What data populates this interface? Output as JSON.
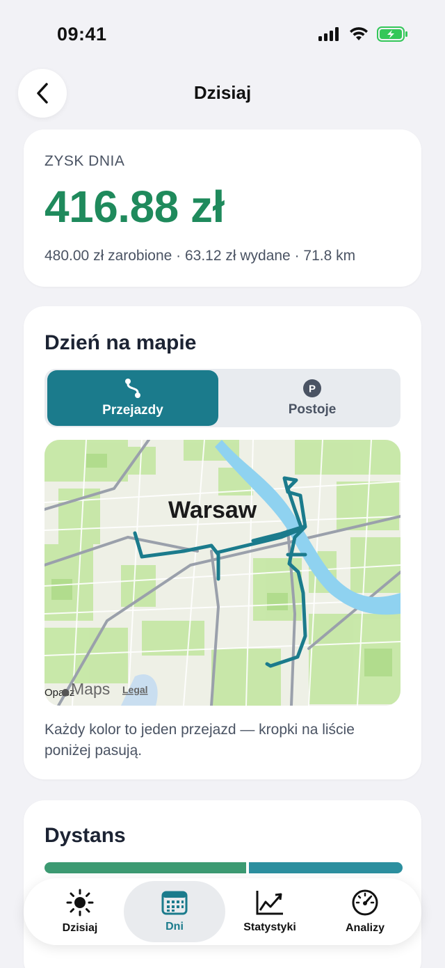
{
  "status_bar": {
    "time": "09:41"
  },
  "header": {
    "title": "Dzisiaj",
    "back_icon": "chevron-left-icon"
  },
  "profit": {
    "label": "ZYSK DNIA",
    "amount": "416.88 zł",
    "summary": "480.00 zł zarobione · 63.12 zł wydane · 71.8 km",
    "color": "#1f8a5c"
  },
  "map_section": {
    "title": "Dzień na mapie",
    "tabs": [
      {
        "label": "Przejazdy",
        "icon": "route-icon",
        "selected": true
      },
      {
        "label": "Postoje",
        "icon": "parking-icon",
        "selected": false
      }
    ],
    "map": {
      "city_label": "Warsaw",
      "attribution_left": "Opacz",
      "maps_label": "Maps",
      "legal_label": "Legal",
      "route_color": "#1b7b8c"
    },
    "note": "Każdy kolor to jeden przejazd — kropki na liście poniżej pasują."
  },
  "distance": {
    "title": "Dystans",
    "segments": [
      {
        "share": 0.51,
        "color": "#3c9a72"
      },
      {
        "share": 0.49,
        "color": "#2c8f9f"
      }
    ]
  },
  "tab_bar": {
    "items": [
      {
        "label": "Dzisiaj",
        "icon": "sun-icon",
        "active": false
      },
      {
        "label": "Dni",
        "icon": "calendar-icon",
        "active": true
      },
      {
        "label": "Statystyki",
        "icon": "chart-icon",
        "active": false
      },
      {
        "label": "Analizy",
        "icon": "gauge-icon",
        "active": false
      }
    ]
  },
  "colors": {
    "accent": "#1b7b8c",
    "background": "#f2f2f6"
  }
}
